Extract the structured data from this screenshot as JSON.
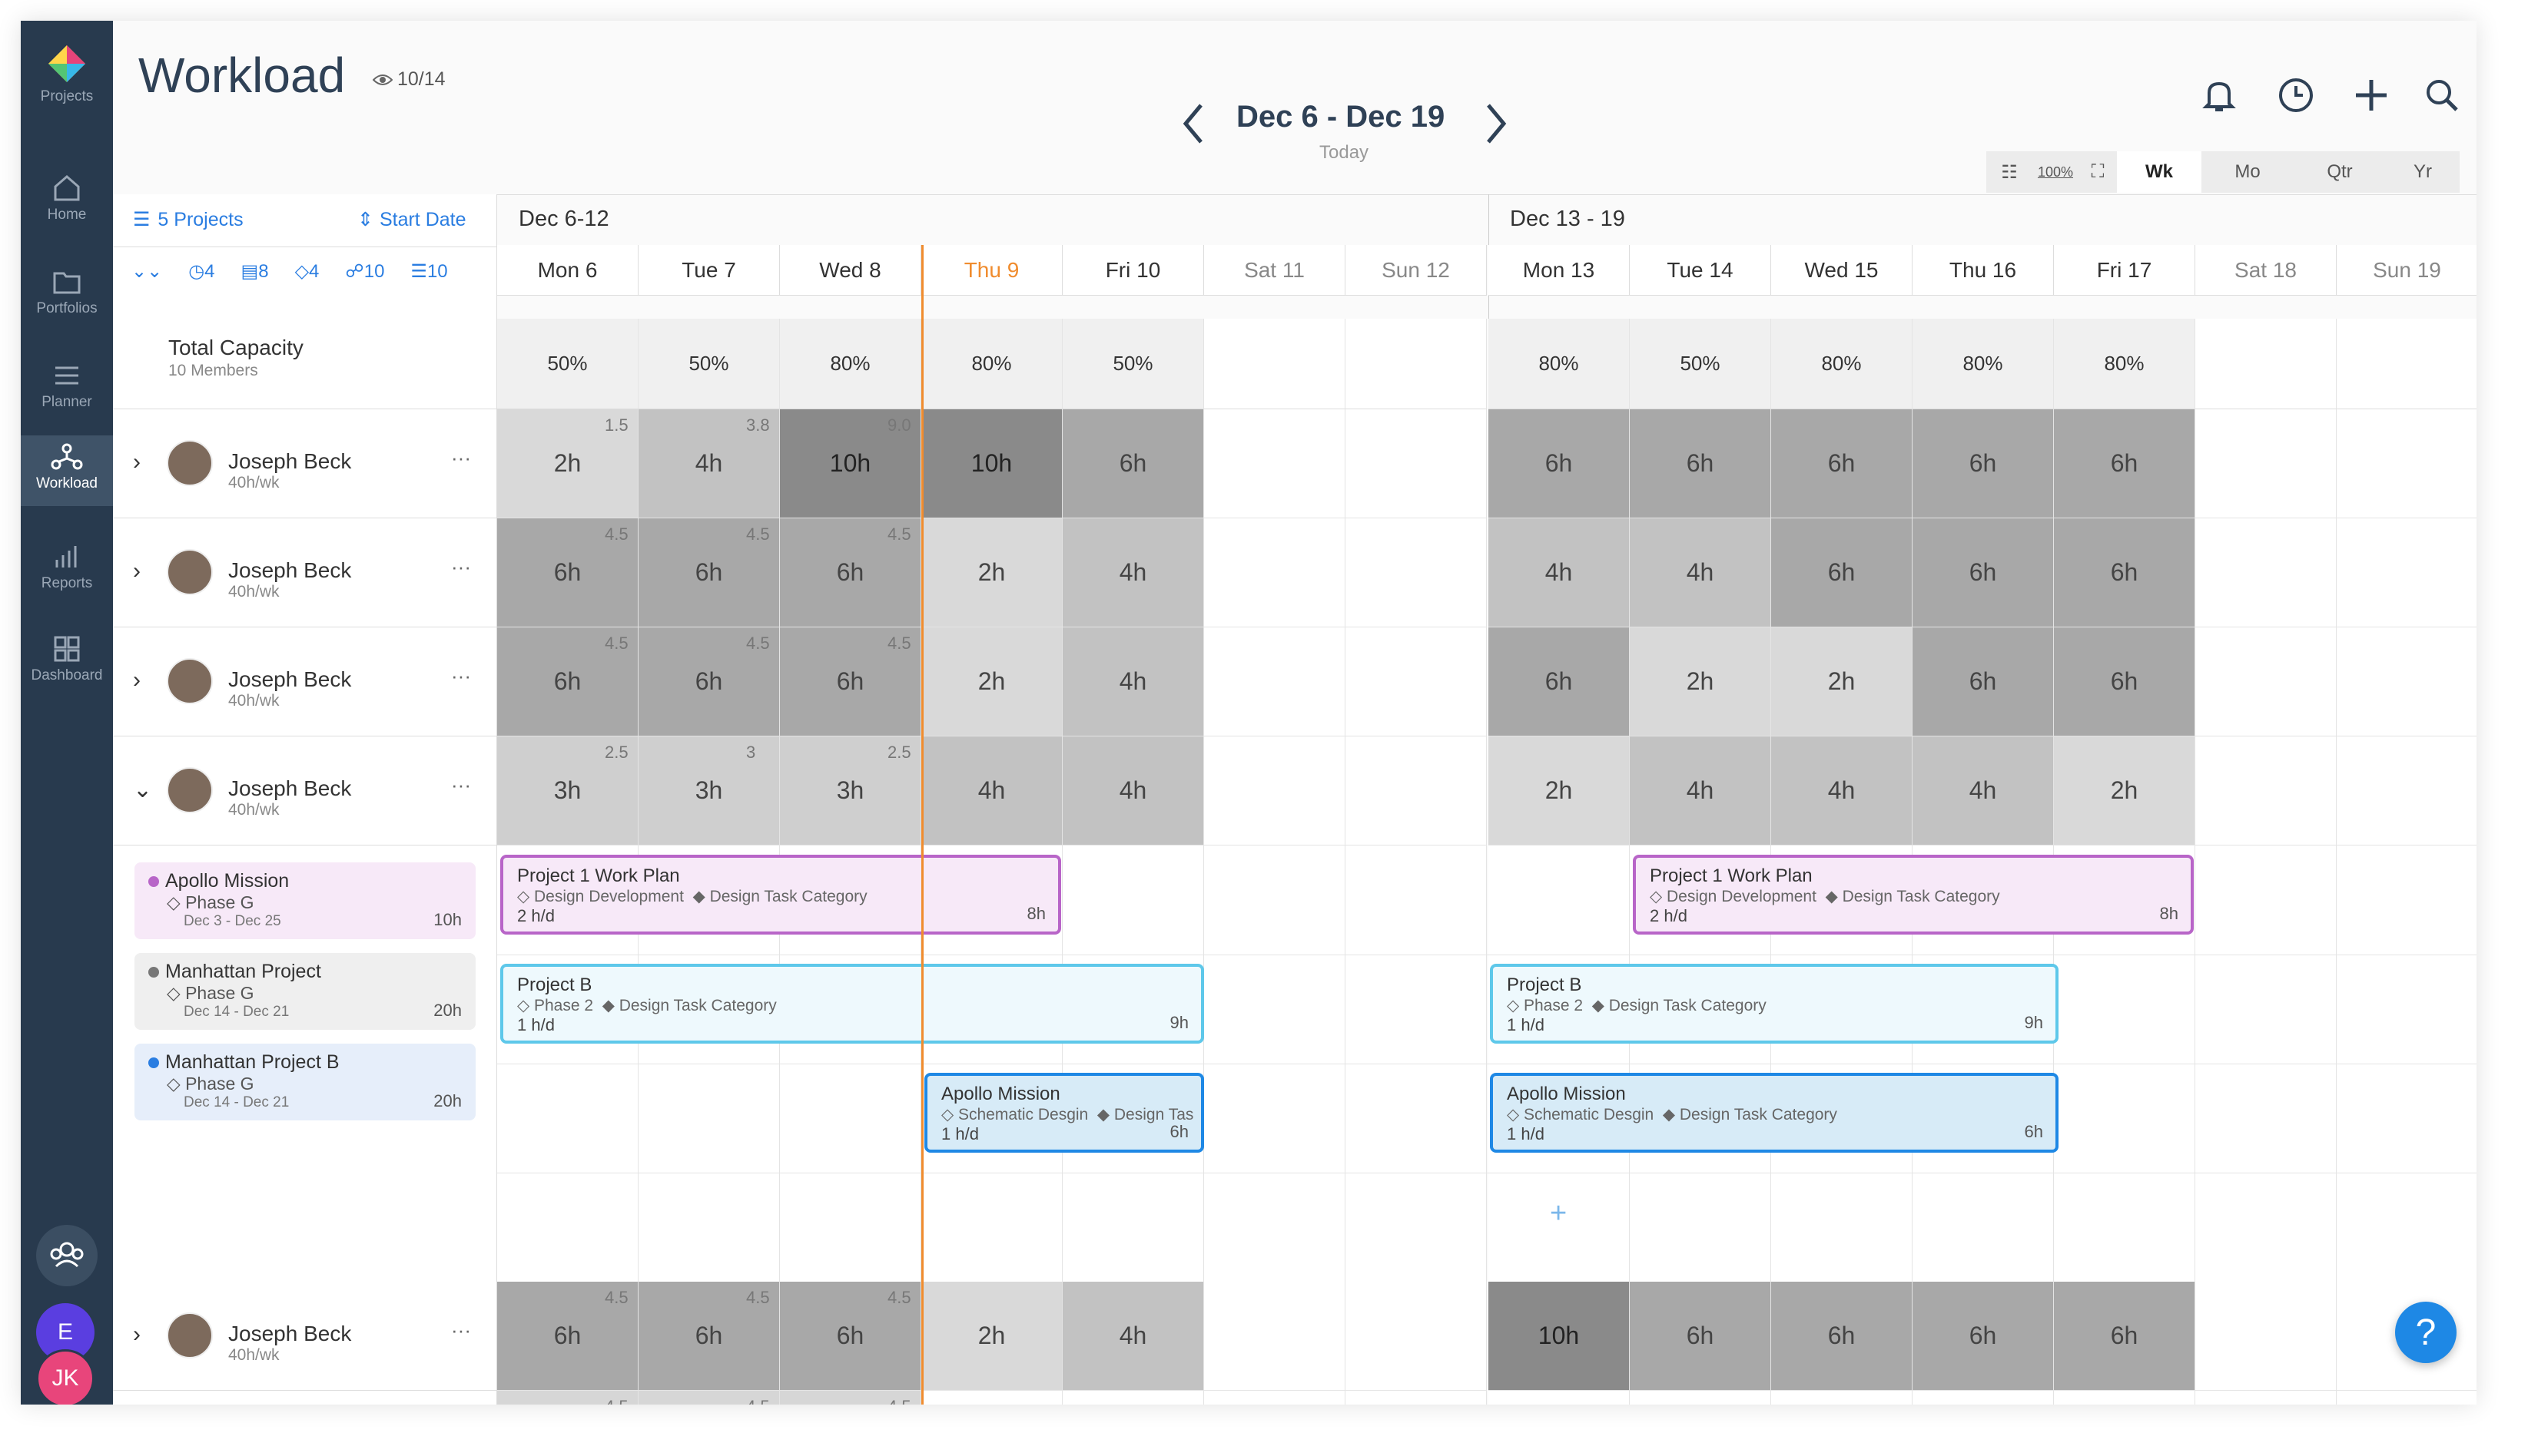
{
  "sidebar": {
    "items": [
      {
        "label": "Projects"
      },
      {
        "label": "Home"
      },
      {
        "label": "Portfolios"
      },
      {
        "label": "Planner"
      },
      {
        "label": "Workload"
      },
      {
        "label": "Reports"
      },
      {
        "label": "Dashboard"
      }
    ],
    "avatar_e": "E",
    "avatar_jk": "JK"
  },
  "header": {
    "title": "Workload",
    "views": "10/14",
    "range": "Dec 6 - Dec 19",
    "today": "Today"
  },
  "zoom": {
    "zoom_pct": "100%",
    "options": [
      "Wk",
      "Mo",
      "Qtr",
      "Yr"
    ],
    "selected": "Wk"
  },
  "filters": {
    "projects": "5 Projects",
    "sort": "Start Date",
    "counts": [
      "4",
      "8",
      "4",
      "10",
      "10"
    ]
  },
  "weeks": [
    "Dec 6-12",
    "Dec 13 - 19"
  ],
  "days": [
    "Mon 6",
    "Tue 7",
    "Wed 8",
    "Thu 9",
    "Fri 10",
    "Sat 11",
    "Sun 12",
    "Mon 13",
    "Tue 14",
    "Wed 15",
    "Thu 16",
    "Fri 17",
    "Sat 18",
    "Sun 19"
  ],
  "capacity": {
    "label": "Total Capacity",
    "members": "10 Members",
    "values": [
      "50%",
      "50%",
      "80%",
      "80%",
      "50%",
      "",
      "",
      "80%",
      "50%",
      "80%",
      "80%",
      "80%",
      "",
      ""
    ]
  },
  "members": [
    {
      "name": "Joseph Beck",
      "rate": "40h/wk",
      "hours": [
        "2h",
        "4h",
        "10h",
        "10h",
        "6h",
        "",
        "",
        "6h",
        "6h",
        "6h",
        "6h",
        "6h",
        "",
        ""
      ],
      "extra": [
        "1.5",
        "3.8",
        "9.0",
        "",
        "",
        "",
        "",
        "",
        "",
        "",
        "",
        "",
        "",
        ""
      ]
    },
    {
      "name": "Joseph Beck",
      "rate": "40h/wk",
      "hours": [
        "6h",
        "6h",
        "6h",
        "2h",
        "4h",
        "",
        "",
        "4h",
        "4h",
        "6h",
        "6h",
        "6h",
        "",
        ""
      ],
      "extra": [
        "4.5",
        "4.5",
        "4.5",
        "",
        "",
        "",
        "",
        "",
        "",
        "",
        "",
        "",
        "",
        ""
      ]
    },
    {
      "name": "Joseph Beck",
      "rate": "40h/wk",
      "hours": [
        "6h",
        "6h",
        "6h",
        "2h",
        "4h",
        "",
        "",
        "6h",
        "2h",
        "2h",
        "6h",
        "6h",
        "",
        ""
      ],
      "extra": [
        "4.5",
        "4.5",
        "4.5",
        "",
        "",
        "",
        "",
        "",
        "",
        "",
        "",
        "",
        "",
        ""
      ]
    },
    {
      "name": "Joseph Beck",
      "rate": "40h/wk",
      "hours": [
        "3h",
        "3h",
        "3h",
        "4h",
        "4h",
        "",
        "",
        "2h",
        "4h",
        "4h",
        "4h",
        "2h",
        "",
        ""
      ],
      "extra": [
        "2.5",
        "3",
        "2.5",
        "",
        "",
        "",
        "",
        "",
        "",
        "",
        "",
        "",
        "",
        ""
      ]
    },
    {
      "name": "Joseph Beck",
      "rate": "40h/wk",
      "hours": [
        "6h",
        "6h",
        "6h",
        "2h",
        "4h",
        "",
        "",
        "10h",
        "6h",
        "6h",
        "6h",
        "6h",
        "",
        ""
      ],
      "extra": [
        "4.5",
        "4.5",
        "4.5",
        "",
        "",
        "",
        "",
        "",
        "",
        "",
        "",
        "",
        "",
        ""
      ]
    },
    {
      "name": "",
      "rate": "",
      "hours": [
        "",
        "",
        "",
        "",
        "",
        "",
        "",
        "",
        "",
        "",
        "",
        "",
        "",
        ""
      ],
      "extra": [
        "4.5",
        "4.5",
        "4.5",
        "",
        "",
        "",
        "",
        "",
        "",
        "",
        "",
        "",
        "",
        ""
      ]
    }
  ],
  "projects": [
    {
      "name": "Apollo Mission",
      "phase": "Phase G",
      "dates": "Dec 3 - Dec 25",
      "hours": "10h",
      "color": "#b865c8"
    },
    {
      "name": "Manhattan Project",
      "phase": "Phase G",
      "dates": "Dec 14 - Dec 21",
      "hours": "20h",
      "color": "#777777"
    },
    {
      "name": "Manhattan Project B",
      "phase": "Phase G",
      "dates": "Dec 14 - Dec 21",
      "hours": "20h",
      "color": "#2a7de1"
    }
  ],
  "bars": [
    {
      "title": "Project 1 Work Plan",
      "meta1": "Design Development",
      "meta2": "Design Task Category",
      "rate": "2 h/d",
      "est": "8h"
    },
    {
      "title": "Project 1 Work Plan",
      "meta1": "Design Development",
      "meta2": "Design Task Category",
      "rate": "2 h/d",
      "est": "8h"
    },
    {
      "title": "Project B",
      "meta1": "Phase 2",
      "meta2": "Design Task Category",
      "rate": "1 h/d",
      "est": "9h"
    },
    {
      "title": "Project B",
      "meta1": "Phase 2",
      "meta2": "Design Task Category",
      "rate": "1 h/d",
      "est": "9h"
    },
    {
      "title": "Apollo Mission",
      "meta1": "Schematic Desgin",
      "meta2": "Design Tas",
      "rate": "1 h/d",
      "est": "6h"
    },
    {
      "title": "Apollo Mission",
      "meta1": "Schematic Desgin",
      "meta2": "Design Task Category",
      "rate": "1 h/d",
      "est": "6h"
    }
  ],
  "help": "?",
  "colors": {
    "sidebar": "#283a4e",
    "today": "#f08c2e",
    "accent": "#2a7de1",
    "help": "#1e88e5"
  }
}
